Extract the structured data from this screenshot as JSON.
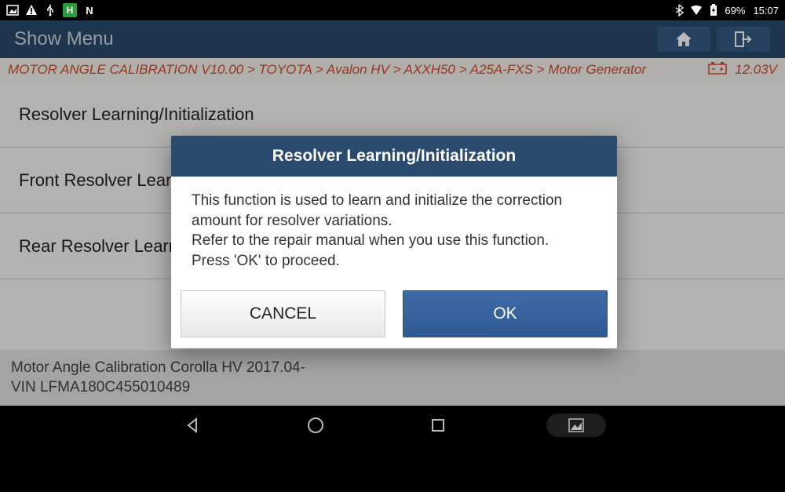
{
  "status_bar": {
    "battery_pct": "69%",
    "time": "15:07"
  },
  "header": {
    "title": "Show Menu"
  },
  "breadcrumb": {
    "path": "MOTOR ANGLE CALIBRATION V10.00 > TOYOTA > Avalon HV > AXXH50 > A25A-FXS > Motor Generator",
    "voltage": "12.03V"
  },
  "menu_items": [
    {
      "label": "Resolver Learning/Initialization"
    },
    {
      "label": "Front Resolver Learning/Initialization"
    },
    {
      "label": "Rear Resolver Learning/Initialization"
    }
  ],
  "footer": {
    "line1": "Motor Angle Calibration Corolla HV 2017.04-",
    "line2": "VIN LFMA180C455010489"
  },
  "dialog": {
    "title": "Resolver Learning/Initialization",
    "body_line1": "This function is used to learn and initialize the correction amount for resolver variations.",
    "body_line2": "Refer to the repair manual when you use this function.",
    "body_line3": "Press 'OK' to proceed.",
    "cancel": "CANCEL",
    "ok": "OK"
  }
}
